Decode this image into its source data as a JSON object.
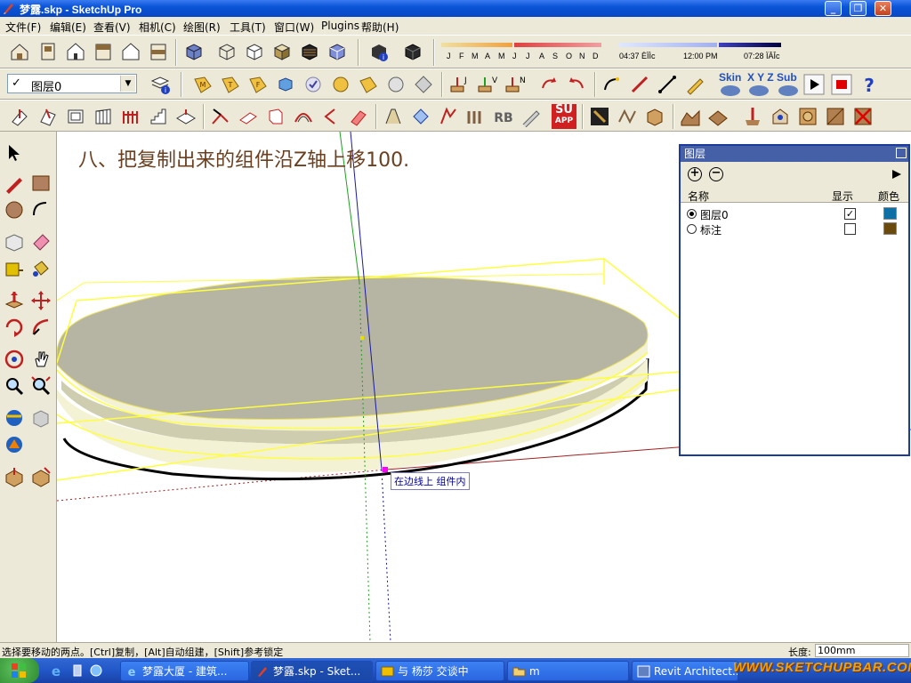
{
  "window": {
    "title": "梦露.skp - SketchUp Pro"
  },
  "menu": [
    "文件(F)",
    "编辑(E)",
    "查看(V)",
    "相机(C)",
    "绘图(R)",
    "工具(T)",
    "窗口(W)",
    "Plugins",
    "帮助(H)"
  ],
  "shadow": {
    "months": [
      "J",
      "F",
      "M",
      "A",
      "M",
      "J",
      "J",
      "A",
      "S",
      "O",
      "N",
      "D"
    ],
    "sunrise": "04:37 ÈÏÌc",
    "noon": "12:00 PM",
    "sunset": "07:28 ÏÂÎc"
  },
  "layer_select": {
    "value": "图层0"
  },
  "toolbar_text": {
    "skin": "Skin",
    "xyz": "X Y Z",
    "sub": "Sub",
    "su_app": "SU",
    "su_app2": "APP"
  },
  "viewport": {
    "step_text": "八、把复制出来的组件沿Z轴上移100.",
    "tooltip": "在边线上  组件内"
  },
  "layers_panel": {
    "title": "图层",
    "col_name": "名称",
    "col_visible": "显示",
    "col_color": "颜色",
    "rows": [
      {
        "name": "图层0",
        "active": true,
        "visible": "✓",
        "color": "#0e6fa4"
      },
      {
        "name": "标注",
        "active": false,
        "visible": "",
        "color": "#6b4a0e"
      }
    ]
  },
  "status": {
    "message": "选择要移动的两点。[Ctrl]复制，[Alt]自动组建，[Shift]参考锁定",
    "length_label": "长度:",
    "length_value": "100mm"
  },
  "taskbar": {
    "items": [
      "梦露大厦 - 建筑...",
      "梦露.skp - Sket...",
      "与 杨莎 交谈中",
      "m",
      "Revit Architect..."
    ],
    "watermark": "WWW.SKETCHUPBAR.COM"
  },
  "colors": {
    "selection": "#ffff40",
    "top_face": "#b6b5a3",
    "side_face": "#f4f2d4",
    "axis_blue": "#1a1aa0",
    "axis_green": "#20a020",
    "axis_red": "#a02020",
    "step_text": "#6b4020"
  }
}
